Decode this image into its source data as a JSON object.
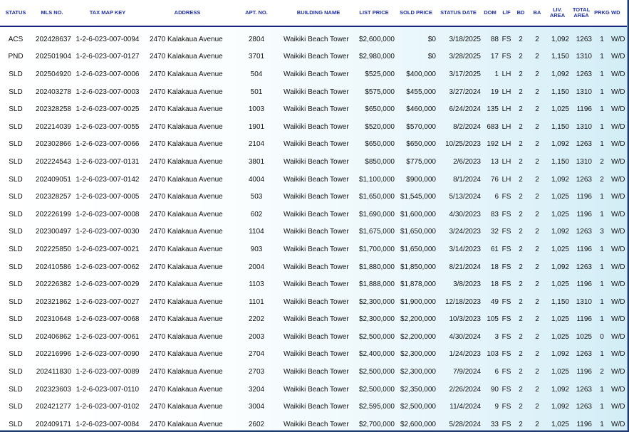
{
  "columns": [
    {
      "key": "status",
      "label": "STATUS"
    },
    {
      "key": "mls",
      "label": "MLS NO."
    },
    {
      "key": "tmk",
      "label": "TAX MAP KEY"
    },
    {
      "key": "address",
      "label": "ADDRESS"
    },
    {
      "key": "apt",
      "label": "APT. NO."
    },
    {
      "key": "building",
      "label": "BUILDING NAME"
    },
    {
      "key": "list_price",
      "label": "LIST PRICE"
    },
    {
      "key": "sold_price",
      "label": "SOLD PRICE"
    },
    {
      "key": "status_date",
      "label": "STATUS DATE"
    },
    {
      "key": "dom",
      "label": "DOM"
    },
    {
      "key": "lf",
      "label": "L/F"
    },
    {
      "key": "bd",
      "label": "BD"
    },
    {
      "key": "ba",
      "label": "BA"
    },
    {
      "key": "liv_area",
      "label": "LIV.\nAREA"
    },
    {
      "key": "total_area",
      "label": "TOTAL\nAREA"
    },
    {
      "key": "prkg",
      "label": "PRKG"
    },
    {
      "key": "wd",
      "label": "WD"
    }
  ],
  "rows": [
    {
      "status": "ACS",
      "mls": "202428637",
      "tmk": "1-2-6-023-007-0094",
      "address": "2470 Kalakaua Avenue",
      "apt": "2804",
      "building": "Waikiki Beach Tower",
      "list_price": "$2,600,000",
      "sold_price": "$0",
      "status_date": "3/18/2025",
      "dom": "88",
      "lf": "FS",
      "bd": "2",
      "ba": "2",
      "liv_area": "1,092",
      "total_area": "1263",
      "prkg": "1",
      "wd": "W/D"
    },
    {
      "status": "PND",
      "mls": "202501904",
      "tmk": "1-2-6-023-007-0127",
      "address": "2470 Kalakaua Avenue",
      "apt": "3701",
      "building": "Waikiki Beach Tower",
      "list_price": "$2,980,000",
      "sold_price": "$0",
      "status_date": "3/28/2025",
      "dom": "17",
      "lf": "FS",
      "bd": "2",
      "ba": "2",
      "liv_area": "1,150",
      "total_area": "1310",
      "prkg": "1",
      "wd": "W/D"
    },
    {
      "status": "SLD",
      "mls": "202504920",
      "tmk": "1-2-6-023-007-0006",
      "address": "2470 Kalakaua Avenue",
      "apt": "504",
      "building": "Waikiki Beach Tower",
      "list_price": "$525,000",
      "sold_price": "$400,000",
      "status_date": "3/17/2025",
      "dom": "1",
      "lf": "LH",
      "bd": "2",
      "ba": "2",
      "liv_area": "1,092",
      "total_area": "1263",
      "prkg": "1",
      "wd": "W/D"
    },
    {
      "status": "SLD",
      "mls": "202403278",
      "tmk": "1-2-6-023-007-0003",
      "address": "2470 Kalakaua Avenue",
      "apt": "501",
      "building": "Waikiki Beach Tower",
      "list_price": "$575,000",
      "sold_price": "$455,000",
      "status_date": "3/27/2024",
      "dom": "19",
      "lf": "LH",
      "bd": "2",
      "ba": "2",
      "liv_area": "1,150",
      "total_area": "1310",
      "prkg": "1",
      "wd": "W/D"
    },
    {
      "status": "SLD",
      "mls": "202328258",
      "tmk": "1-2-6-023-007-0025",
      "address": "2470 Kalakaua Avenue",
      "apt": "1003",
      "building": "Waikiki Beach Tower",
      "list_price": "$650,000",
      "sold_price": "$460,000",
      "status_date": "6/24/2024",
      "dom": "135",
      "lf": "LH",
      "bd": "2",
      "ba": "2",
      "liv_area": "1,025",
      "total_area": "1196",
      "prkg": "1",
      "wd": "W/D"
    },
    {
      "status": "SLD",
      "mls": "202214039",
      "tmk": "1-2-6-023-007-0055",
      "address": "2470 Kalakaua Avenue",
      "apt": "1901",
      "building": "Waikiki Beach Tower",
      "list_price": "$520,000",
      "sold_price": "$570,000",
      "status_date": "8/2/2024",
      "dom": "683",
      "lf": "LH",
      "bd": "2",
      "ba": "2",
      "liv_area": "1,150",
      "total_area": "1310",
      "prkg": "1",
      "wd": "W/D"
    },
    {
      "status": "SLD",
      "mls": "202302866",
      "tmk": "1-2-6-023-007-0066",
      "address": "2470 Kalakaua Avenue",
      "apt": "2104",
      "building": "Waikiki Beach Tower",
      "list_price": "$650,000",
      "sold_price": "$650,000",
      "status_date": "10/25/2023",
      "dom": "192",
      "lf": "LH",
      "bd": "2",
      "ba": "2",
      "liv_area": "1,092",
      "total_area": "1263",
      "prkg": "1",
      "wd": "W/D"
    },
    {
      "status": "SLD",
      "mls": "202224543",
      "tmk": "1-2-6-023-007-0131",
      "address": "2470 Kalakaua Avenue",
      "apt": "3801",
      "building": "Waikiki Beach Tower",
      "list_price": "$850,000",
      "sold_price": "$775,000",
      "status_date": "2/6/2023",
      "dom": "13",
      "lf": "LH",
      "bd": "2",
      "ba": "2",
      "liv_area": "1,150",
      "total_area": "1310",
      "prkg": "2",
      "wd": "W/D"
    },
    {
      "status": "SLD",
      "mls": "202409051",
      "tmk": "1-2-6-023-007-0142",
      "address": "2470 Kalakaua Avenue",
      "apt": "4004",
      "building": "Waikiki Beach Tower",
      "list_price": "$1,100,000",
      "sold_price": "$900,000",
      "status_date": "8/1/2024",
      "dom": "76",
      "lf": "LH",
      "bd": "2",
      "ba": "2",
      "liv_area": "1,092",
      "total_area": "1263",
      "prkg": "2",
      "wd": "W/D"
    },
    {
      "status": "SLD",
      "mls": "202328257",
      "tmk": "1-2-6-023-007-0005",
      "address": "2470 Kalakaua Avenue",
      "apt": "503",
      "building": "Waikiki Beach Tower",
      "list_price": "$1,650,000",
      "sold_price": "$1,545,000",
      "status_date": "5/13/2024",
      "dom": "6",
      "lf": "FS",
      "bd": "2",
      "ba": "2",
      "liv_area": "1,025",
      "total_area": "1196",
      "prkg": "1",
      "wd": "W/D"
    },
    {
      "status": "SLD",
      "mls": "202226199",
      "tmk": "1-2-6-023-007-0008",
      "address": "2470 Kalakaua Avenue",
      "apt": "602",
      "building": "Waikiki Beach Tower",
      "list_price": "$1,690,000",
      "sold_price": "$1,600,000",
      "status_date": "4/30/2023",
      "dom": "83",
      "lf": "FS",
      "bd": "2",
      "ba": "2",
      "liv_area": "1,025",
      "total_area": "1196",
      "prkg": "1",
      "wd": "W/D"
    },
    {
      "status": "SLD",
      "mls": "202300497",
      "tmk": "1-2-6-023-007-0030",
      "address": "2470 Kalakaua Avenue",
      "apt": "1104",
      "building": "Waikiki Beach Tower",
      "list_price": "$1,675,000",
      "sold_price": "$1,650,000",
      "status_date": "3/24/2023",
      "dom": "32",
      "lf": "FS",
      "bd": "2",
      "ba": "2",
      "liv_area": "1,092",
      "total_area": "1263",
      "prkg": "3",
      "wd": "W/D"
    },
    {
      "status": "SLD",
      "mls": "202225850",
      "tmk": "1-2-6-023-007-0021",
      "address": "2470 Kalakaua Avenue",
      "apt": "903",
      "building": "Waikiki Beach Tower",
      "list_price": "$1,700,000",
      "sold_price": "$1,650,000",
      "status_date": "3/14/2023",
      "dom": "61",
      "lf": "FS",
      "bd": "2",
      "ba": "2",
      "liv_area": "1,025",
      "total_area": "1196",
      "prkg": "1",
      "wd": "W/D"
    },
    {
      "status": "SLD",
      "mls": "202410586",
      "tmk": "1-2-6-023-007-0062",
      "address": "2470 Kalakaua Avenue",
      "apt": "2004",
      "building": "Waikiki Beach Tower",
      "list_price": "$1,880,000",
      "sold_price": "$1,850,000",
      "status_date": "8/21/2024",
      "dom": "18",
      "lf": "FS",
      "bd": "2",
      "ba": "2",
      "liv_area": "1,092",
      "total_area": "1263",
      "prkg": "1",
      "wd": "W/D"
    },
    {
      "status": "SLD",
      "mls": "202226382",
      "tmk": "1-2-6-023-007-0029",
      "address": "2470 Kalakaua Avenue",
      "apt": "1103",
      "building": "Waikiki Beach Tower",
      "list_price": "$1,888,000",
      "sold_price": "$1,878,000",
      "status_date": "3/8/2023",
      "dom": "18",
      "lf": "FS",
      "bd": "2",
      "ba": "2",
      "liv_area": "1,025",
      "total_area": "1196",
      "prkg": "1",
      "wd": "W/D"
    },
    {
      "status": "SLD",
      "mls": "202321862",
      "tmk": "1-2-6-023-007-0027",
      "address": "2470 Kalakaua Avenue",
      "apt": "1101",
      "building": "Waikiki Beach Tower",
      "list_price": "$2,300,000",
      "sold_price": "$1,900,000",
      "status_date": "12/18/2023",
      "dom": "49",
      "lf": "FS",
      "bd": "2",
      "ba": "2",
      "liv_area": "1,150",
      "total_area": "1310",
      "prkg": "1",
      "wd": "W/D"
    },
    {
      "status": "SLD",
      "mls": "202310648",
      "tmk": "1-2-6-023-007-0068",
      "address": "2470 Kalakaua Avenue",
      "apt": "2202",
      "building": "Waikiki Beach Tower",
      "list_price": "$2,300,000",
      "sold_price": "$2,200,000",
      "status_date": "10/3/2023",
      "dom": "105",
      "lf": "FS",
      "bd": "2",
      "ba": "2",
      "liv_area": "1,025",
      "total_area": "1196",
      "prkg": "1",
      "wd": "W/D"
    },
    {
      "status": "SLD",
      "mls": "202406862",
      "tmk": "1-2-6-023-007-0061",
      "address": "2470 Kalakaua Avenue",
      "apt": "2003",
      "building": "Waikiki Beach Tower",
      "list_price": "$2,500,000",
      "sold_price": "$2,200,000",
      "status_date": "4/30/2024",
      "dom": "3",
      "lf": "FS",
      "bd": "2",
      "ba": "2",
      "liv_area": "1,025",
      "total_area": "1025",
      "prkg": "0",
      "wd": "W/D"
    },
    {
      "status": "SLD",
      "mls": "202216996",
      "tmk": "1-2-6-023-007-0090",
      "address": "2470 Kalakaua Avenue",
      "apt": "2704",
      "building": "Waikiki Beach Tower",
      "list_price": "$2,400,000",
      "sold_price": "$2,300,000",
      "status_date": "1/24/2023",
      "dom": "103",
      "lf": "FS",
      "bd": "2",
      "ba": "2",
      "liv_area": "1,092",
      "total_area": "1263",
      "prkg": "1",
      "wd": "W/D"
    },
    {
      "status": "SLD",
      "mls": "202411830",
      "tmk": "1-2-6-023-007-0089",
      "address": "2470 Kalakaua Avenue",
      "apt": "2703",
      "building": "Waikiki Beach Tower",
      "list_price": "$2,500,000",
      "sold_price": "$2,300,000",
      "status_date": "7/9/2024",
      "dom": "6",
      "lf": "FS",
      "bd": "2",
      "ba": "2",
      "liv_area": "1,025",
      "total_area": "1196",
      "prkg": "2",
      "wd": "W/D"
    },
    {
      "status": "SLD",
      "mls": "202323603",
      "tmk": "1-2-6-023-007-0110",
      "address": "2470 Kalakaua Avenue",
      "apt": "3204",
      "building": "Waikiki Beach Tower",
      "list_price": "$2,500,000",
      "sold_price": "$2,350,000",
      "status_date": "2/26/2024",
      "dom": "90",
      "lf": "FS",
      "bd": "2",
      "ba": "2",
      "liv_area": "1,092",
      "total_area": "1263",
      "prkg": "1",
      "wd": "W/D"
    },
    {
      "status": "SLD",
      "mls": "202421277",
      "tmk": "1-2-6-023-007-0102",
      "address": "2470 Kalakaua Avenue",
      "apt": "3004",
      "building": "Waikiki Beach Tower",
      "list_price": "$2,595,000",
      "sold_price": "$2,500,000",
      "status_date": "11/4/2024",
      "dom": "9",
      "lf": "FS",
      "bd": "2",
      "ba": "2",
      "liv_area": "1,092",
      "total_area": "1263",
      "prkg": "1",
      "wd": "W/D"
    },
    {
      "status": "SLD",
      "mls": "202409171",
      "tmk": "1-2-6-023-007-0084",
      "address": "2470 Kalakaua Avenue",
      "apt": "2602",
      "building": "Waikiki Beach Tower",
      "list_price": "$2,700,000",
      "sold_price": "$2,600,000",
      "status_date": "5/28/2024",
      "dom": "33",
      "lf": "FS",
      "bd": "2",
      "ba": "2",
      "liv_area": "1,025",
      "total_area": "1196",
      "prkg": "1",
      "wd": "W/D"
    }
  ]
}
